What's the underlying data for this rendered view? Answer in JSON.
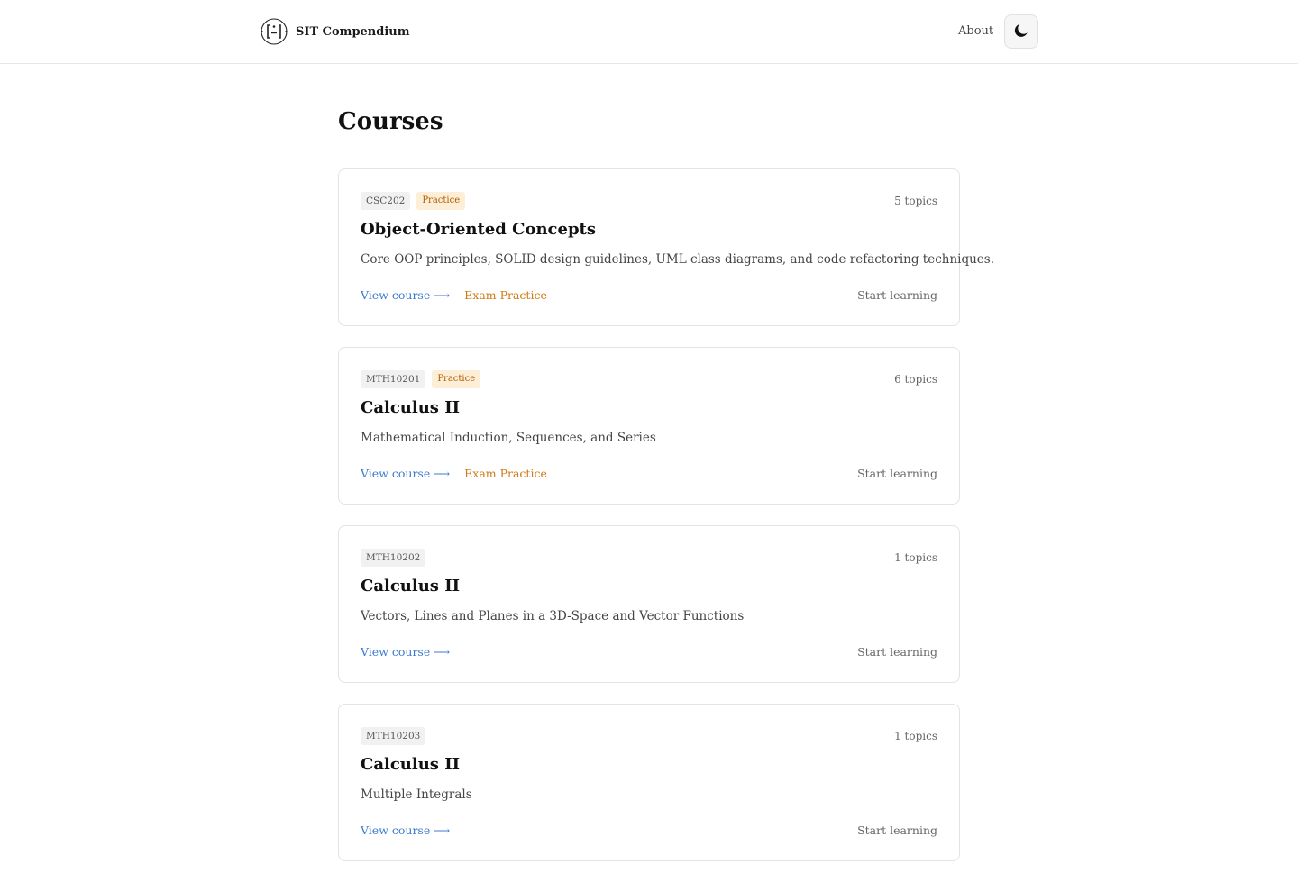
{
  "header": {
    "brand_name": "SIT Compendium",
    "logo_icon": "bracket-logo-icon",
    "nav_about": "About",
    "theme_icon": "moon-icon"
  },
  "main": {
    "title": "Courses"
  },
  "courses": [
    {
      "code": "CSC202",
      "practice_badge": "Practice",
      "topics": "5 topics",
      "title": "Object-Oriented Concepts",
      "description": "Core OOP principles, SOLID design guidelines, UML class diagrams, and code refactoring techniques.",
      "view_link": "View course ⟶",
      "exam_link": "Exam Practice",
      "start": "Start learning"
    },
    {
      "code": "MTH10201",
      "practice_badge": "Practice",
      "topics": "6 topics",
      "title": "Calculus II",
      "description": "Mathematical Induction, Sequences, and Series",
      "view_link": "View course ⟶",
      "exam_link": "Exam Practice",
      "start": "Start learning"
    },
    {
      "code": "MTH10202",
      "topics": "1 topics",
      "title": "Calculus II",
      "description": "Vectors, Lines and Planes in a 3D-Space and Vector Functions",
      "view_link": "View course ⟶",
      "start": "Start learning"
    },
    {
      "code": "MTH10203",
      "topics": "1 topics",
      "title": "Calculus II",
      "description": "Multiple Integrals",
      "view_link": "View course ⟶",
      "start": "Start learning"
    }
  ],
  "colors": {
    "link_blue": "#3b7ad0",
    "exam_orange": "#cf7a12",
    "practice_badge_bg": "#fdeed8",
    "practice_badge_text": "#b35a00"
  }
}
